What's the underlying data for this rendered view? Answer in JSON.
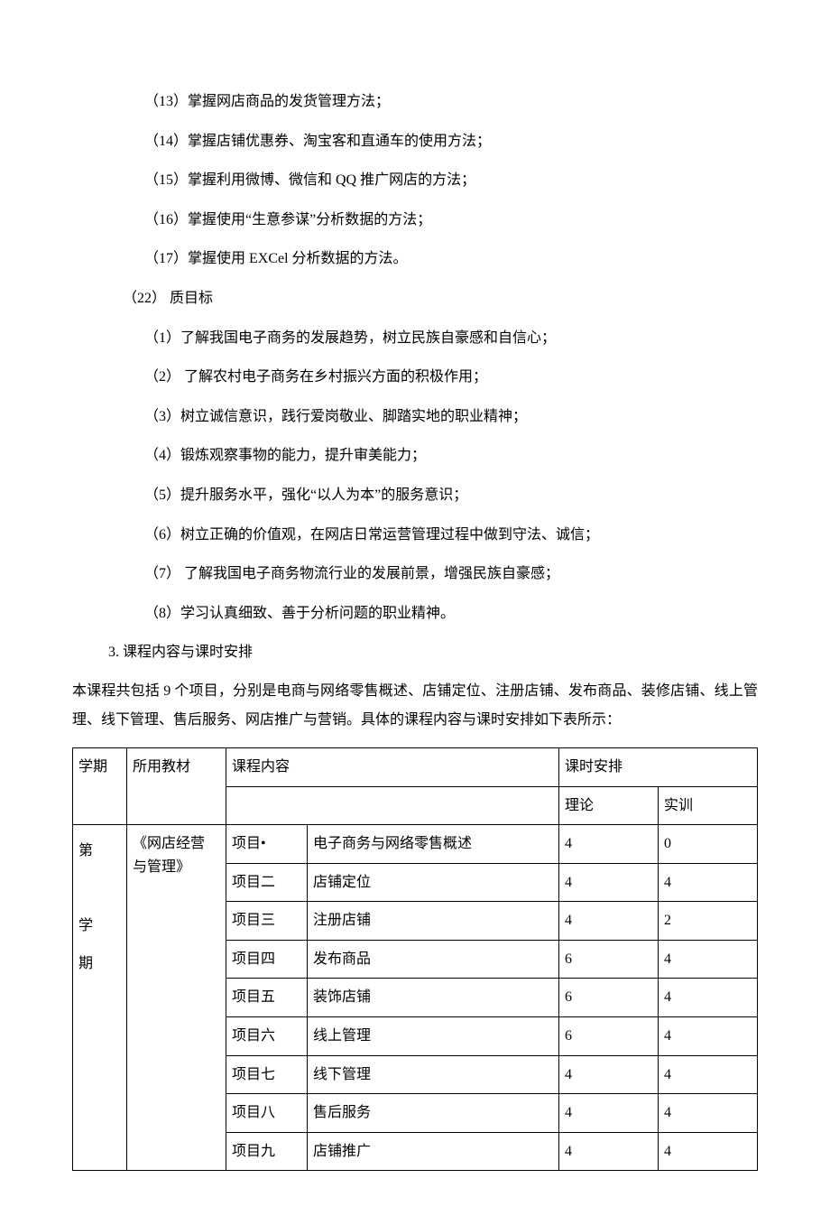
{
  "items_a": [
    "（13）掌握网店商品的发货管理方法；",
    "（14）掌握店铺优惠券、淘宝客和直通车的使用方法；",
    "（15）掌握利用微博、微信和 QQ 推广网店的方法；",
    "（16）掌握使用“生意参谋”分析数据的方法；",
    "（17）掌握使用 EXCel 分析数据的方法。"
  ],
  "heading_22": "（22）  质目标",
  "items_b": [
    "（1）了解我国电子商务的发展趋势，树立民族自豪感和自信心；",
    "（2）  了解农村电子商务在乡村振兴方面的积极作用；",
    "（3）树立诚信意识，践行爱岗敬业、脚踏实地的职业精神；",
    "（4）锻炼观察事物的能力，提升审美能力；",
    "（5）提升服务水平，强化“以人为本”的服务意识；",
    "（6）树立正确的价值观，在网店日常运营管理过程中做到守法、诚信；",
    "（7）  了解我国电子商务物流行业的发展前景，增强民族自豪感；",
    "（8）学习认真细致、善于分析问题的职业精神。"
  ],
  "section3": "3. 课程内容与课时安排",
  "intro": "本课程共包括 9 个项目，分别是电商与网络零售概述、店铺定位、注册店铺、发布商品、装修店铺、线上管理、线下管理、售后服务、网店推广与营销。具体的课程内容与课时安排如下表所示：",
  "table": {
    "headers": {
      "semester": "学期",
      "textbook": "所用教材",
      "content": "课程内容",
      "schedule": "课时安排",
      "theory": "理论",
      "practice": "实训"
    },
    "semester_lines": [
      "第",
      "",
      "学",
      "期"
    ],
    "textbook_lines": [
      "《网店经营",
      "与管理》"
    ],
    "rows": [
      {
        "proj": "项目•",
        "name": "电子商务与网络零售概述",
        "theory": "4",
        "practice": "0"
      },
      {
        "proj": "项目二",
        "name": "店铺定位",
        "theory": "4",
        "practice": "4"
      },
      {
        "proj": "项目三",
        "name": "注册店铺",
        "theory": "4",
        "practice": "2"
      },
      {
        "proj": "项目四",
        "name": "发布商品",
        "theory": "6",
        "practice": "4"
      },
      {
        "proj": "项目五",
        "name": "装饰店铺",
        "theory": "6",
        "practice": "4"
      },
      {
        "proj": "项目六",
        "name": "线上管理",
        "theory": "6",
        "practice": "4"
      },
      {
        "proj": "项目七",
        "name": "线下管理",
        "theory": "4",
        "practice": "4"
      },
      {
        "proj": "项目八",
        "name": "售后服务",
        "theory": "4",
        "practice": "4"
      },
      {
        "proj": "项目九",
        "name": "店铺推广",
        "theory": "4",
        "practice": "4"
      }
    ]
  }
}
